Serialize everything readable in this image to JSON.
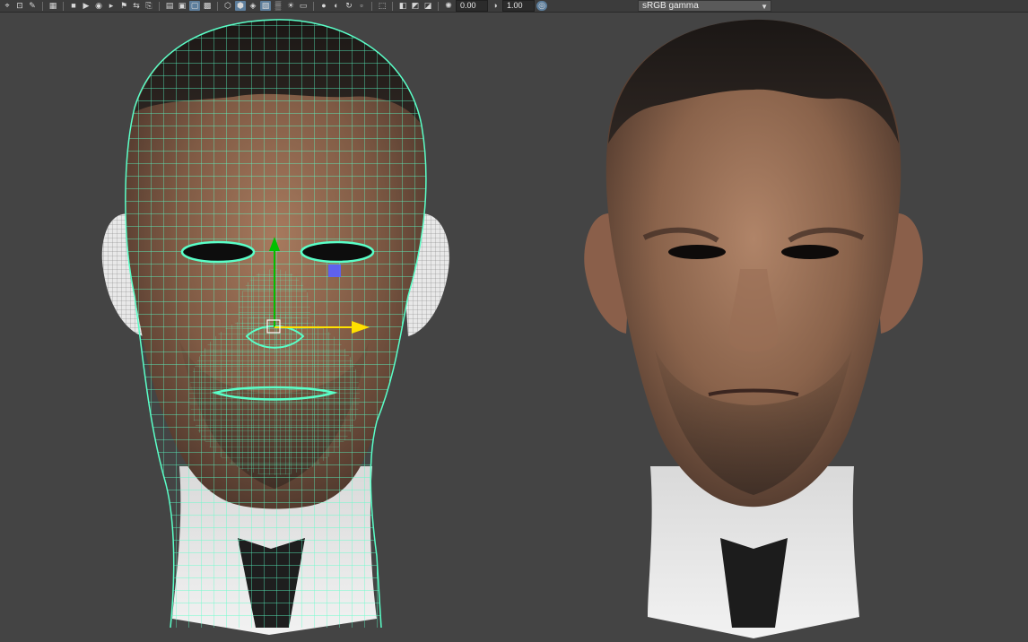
{
  "toolbar": {
    "icons": [
      "select-camera-icon",
      "lock-camera-icon",
      "camera-attributes-icon",
      "bookmarks-icon",
      "image-plane-icon",
      "grid-icon",
      "film-gate-icon",
      "resolution-gate-icon",
      "gate-mask-icon",
      "field-chart-icon",
      "safe-action-icon",
      "wireframe-icon",
      "smooth-shade-icon",
      "default-material-icon",
      "textured-icon",
      "use-all-lights-icon",
      "shadows-icon",
      "ambient-occlusion-icon",
      "motion-blur-icon",
      "anti-aliasing-icon",
      "depth-of-field-icon",
      "isolate-select-icon",
      "xray-icon",
      "xray-joints-icon",
      "backface-icon",
      "exposure-icon",
      "gamma-icon",
      "color-management-icon"
    ],
    "exposure_value": "0.00",
    "gamma_value": "1.00",
    "view_transform": "sRGB gamma"
  },
  "viewport": {
    "background": "#444444",
    "wireframe_color": "#5affc8",
    "manipulator_colors": {
      "x": "#ffe000",
      "y": "#00c000",
      "z": "#5a60ff"
    }
  }
}
